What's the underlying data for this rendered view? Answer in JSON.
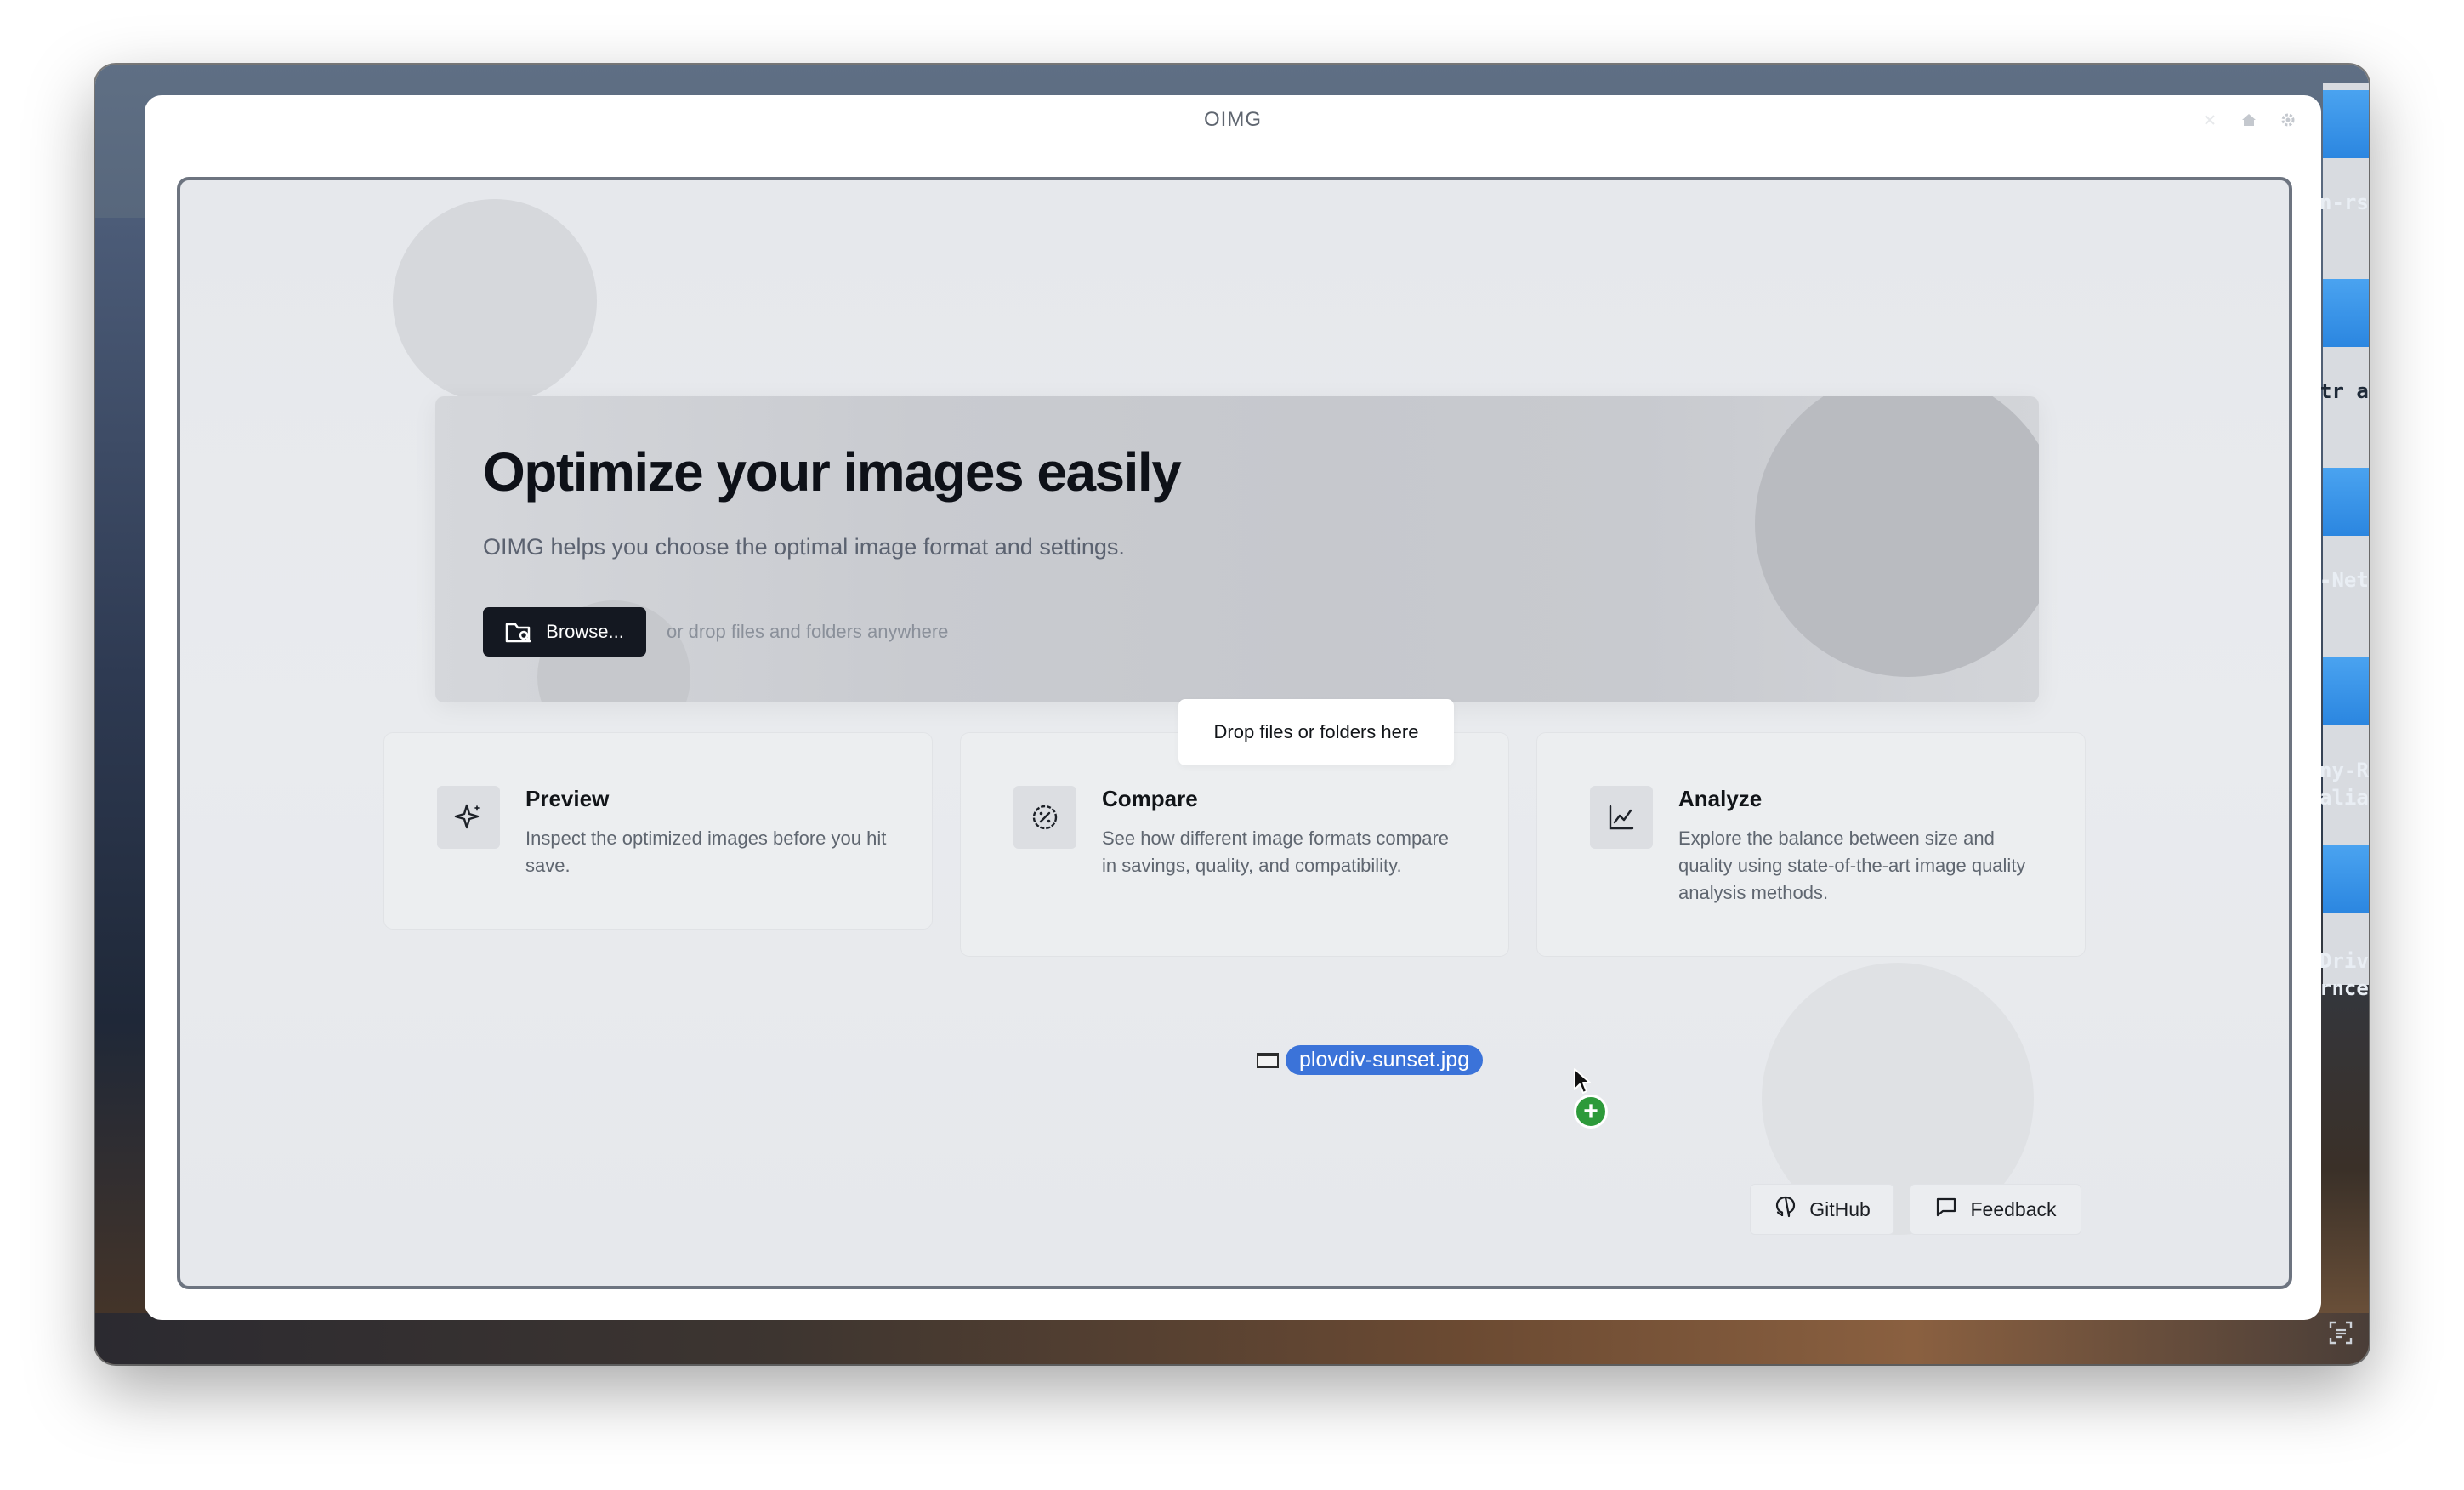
{
  "window": {
    "title": "OIMG"
  },
  "background": {
    "snippets": [
      "n-rs",
      "tr ali",
      "-Net",
      "ny-R",
      "alias",
      "Driv",
      "rnced"
    ]
  },
  "hero": {
    "title": "Optimize your images easily",
    "subtitle": "OIMG helps you choose the optimal image format and settings.",
    "browse_label": "Browse...",
    "drop_hint": "or drop files and folders anywhere"
  },
  "drop_overlay": {
    "tooltip": "Drop files or folders here"
  },
  "features": [
    {
      "icon": "sparkles-icon",
      "title": "Preview",
      "description": "Inspect the optimized images before you hit save."
    },
    {
      "icon": "percent-badge-icon",
      "title": "Compare",
      "description": "See how different image formats compare in savings, quality, and compatibility."
    },
    {
      "icon": "line-chart-icon",
      "title": "Analyze",
      "description": "Explore the balance between size and quality using state-of-the-art image quality analysis methods."
    }
  ],
  "footer": {
    "github_label": "GitHub",
    "feedback_label": "Feedback"
  },
  "drag": {
    "file_name": "plovdiv-sunset.jpg",
    "badge": "+"
  },
  "colors": {
    "primary_button": "#141821",
    "drag_highlight": "#3b73d9",
    "copy_badge": "#2d9a3a"
  }
}
